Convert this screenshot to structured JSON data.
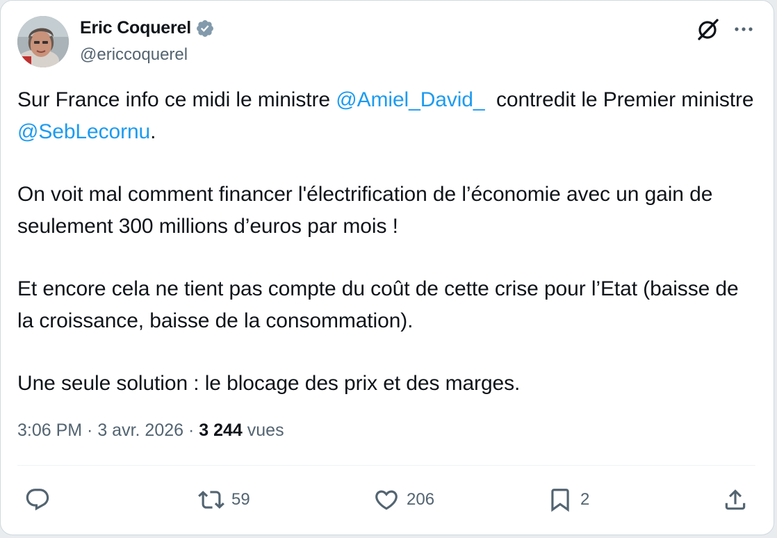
{
  "author": {
    "display_name": "Eric Coquerel",
    "handle": "@ericcoquerel",
    "verified": true
  },
  "tweet": {
    "p1_before": "Sur France info ce midi le ministre ",
    "mention_1": "@Amiel_David_",
    "p1_middle": "  contredit le Premier ministre ",
    "mention_2": "@SebLecornu",
    "p1_after": ".",
    "p2": "On voit mal comment financer l'électrification de l’économie avec un gain de seulement 300 millions d’euros par mois !",
    "p3": "Et encore cela ne tient pas compte du coût de cette crise pour l’Etat (baisse de la croissance, baisse de la consommation).",
    "p4": "Une seule solution : le blocage des prix et des marges."
  },
  "meta": {
    "time": "3:06 PM",
    "separator": " · ",
    "date": "3 avr. 2026",
    "views_count": "3 244",
    "views_label": "vues"
  },
  "actions": {
    "replies": "",
    "reposts": "59",
    "likes": "206",
    "bookmarks": "2"
  },
  "icons": {
    "verified": "verified-badge-icon",
    "grok": "grok-icon",
    "more": "more-icon",
    "reply": "reply-icon",
    "repost": "repost-icon",
    "like": "heart-icon",
    "bookmark": "bookmark-icon",
    "share": "share-icon"
  },
  "colors": {
    "link": "#1d9bf0",
    "text": "#0f1419",
    "secondary": "#536471",
    "verified": "#829aab"
  }
}
